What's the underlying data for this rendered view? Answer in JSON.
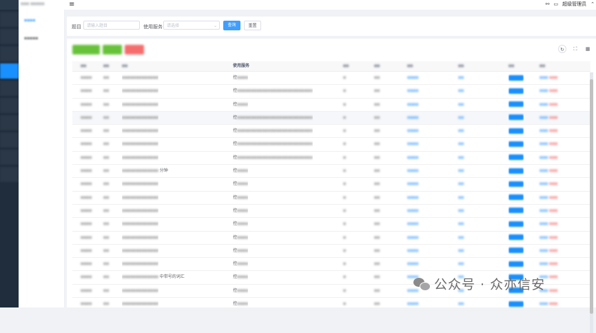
{
  "topbar": {
    "user": "超级管理员"
  },
  "filter": {
    "label_title": "题目",
    "title_placeholder": "请输入题目",
    "label_service": "使用服务",
    "service_placeholder": "请选择",
    "search_label": "查询",
    "reset_label": "重置"
  },
  "table": {
    "service_header": "使用服务",
    "rows": [
      {
        "title": "",
        "service": "控"
      },
      {
        "title": "",
        "service": "控"
      },
      {
        "title": "",
        "service": "控"
      },
      {
        "title": "",
        "service": "控"
      },
      {
        "title": "",
        "service": "控"
      },
      {
        "title": "",
        "service": "控"
      },
      {
        "title": "",
        "service": "控"
      },
      {
        "title": "分钟",
        "service": "控"
      },
      {
        "title": "",
        "service": "控"
      },
      {
        "title": "",
        "service": "控"
      },
      {
        "title": "",
        "service": "控"
      },
      {
        "title": "",
        "service": "控"
      },
      {
        "title": "",
        "service": "控"
      },
      {
        "title": "",
        "service": "控"
      },
      {
        "title": "",
        "service": "控"
      },
      {
        "title": "中带号的词汇",
        "service": "控"
      },
      {
        "title": "",
        "service": "控"
      },
      {
        "title": "",
        "service": "控"
      }
    ]
  },
  "watermark": "公众号 · 众亦信安",
  "colors": {
    "primary": "#1890ff",
    "success": "#67c23a",
    "danger": "#f56c6c",
    "sidebar": "#1f2d3d"
  }
}
